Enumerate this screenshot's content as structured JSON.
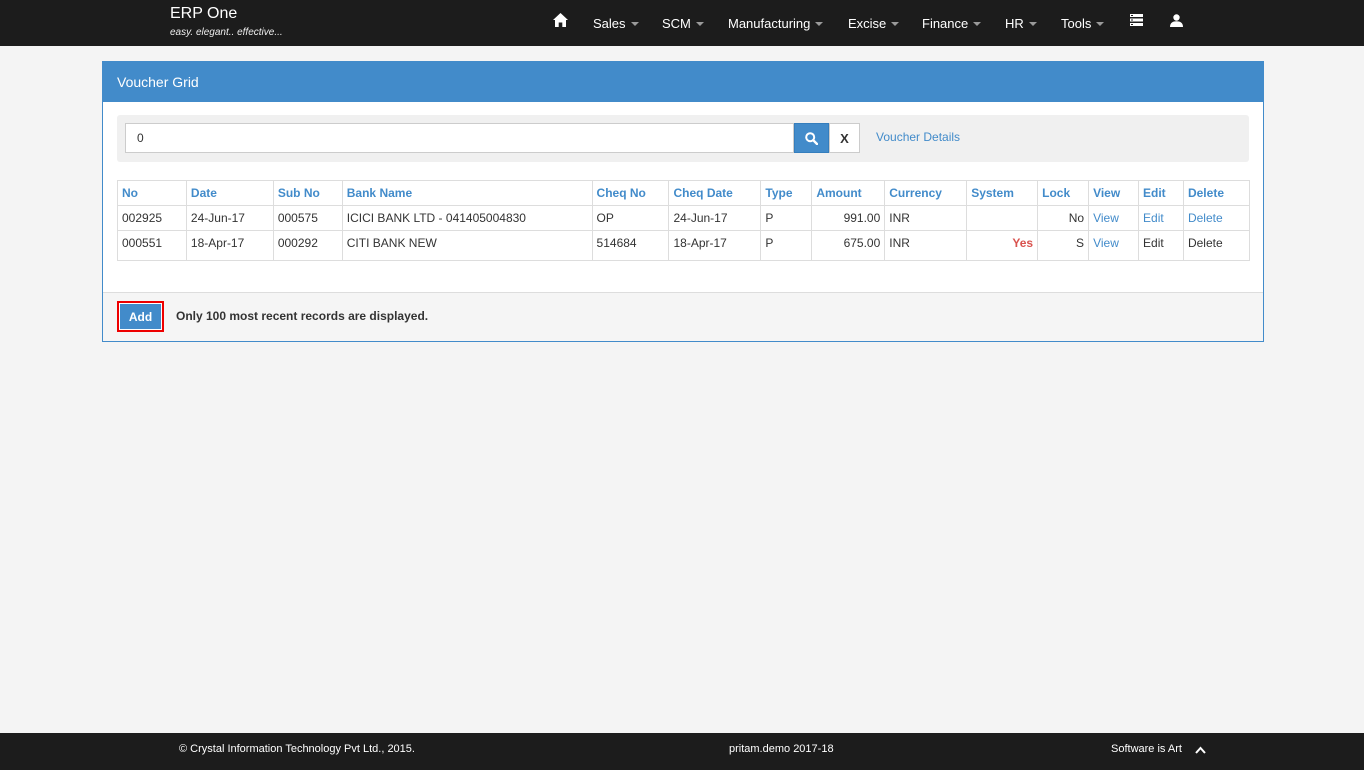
{
  "brand": {
    "title": "ERP One",
    "tagline": "easy. elegant.. effective..."
  },
  "nav": {
    "home_icon": "home-icon",
    "items": [
      "Sales",
      "SCM",
      "Manufacturing",
      "Excise",
      "Finance",
      "HR",
      "Tools"
    ],
    "menu_icon": "list-icon",
    "user_icon": "user-icon"
  },
  "panel": {
    "title": "Voucher Grid",
    "search": {
      "value": "0",
      "button_icon": "search-icon",
      "clear_label": "X"
    },
    "details_link": "Voucher Details"
  },
  "table": {
    "columns": [
      "No",
      "Date",
      "Sub No",
      "Bank Name",
      "Cheq No",
      "Cheq Date",
      "Type",
      "Amount",
      "Currency",
      "System",
      "Lock",
      "View",
      "Edit",
      "Delete"
    ],
    "rows": [
      {
        "no": "002925",
        "date": "24-Jun-17",
        "sub_no": "000575",
        "bank": "ICICI BANK LTD - 041405004830",
        "cheq_no": "OP",
        "cheq_date": "24-Jun-17",
        "type": "P",
        "amount": "991.00",
        "currency": "INR",
        "system": "",
        "lock": "No",
        "view": "View",
        "edit": "Edit",
        "delete": "Delete"
      },
      {
        "no": "000551",
        "date": "18-Apr-17",
        "sub_no": "000292",
        "bank": "CITI BANK NEW",
        "cheq_no": "514684",
        "cheq_date": "18-Apr-17",
        "type": "P",
        "amount": "675.00",
        "currency": "INR",
        "system": "Yes",
        "lock": "S",
        "view": "View",
        "edit": "Edit",
        "delete": "Delete"
      }
    ]
  },
  "footer": {
    "add_label": "Add",
    "note": "Only 100 most recent records are displayed."
  },
  "bottombar": {
    "copyright": "© Crystal Information Technology Pvt Ltd., 2015.",
    "session": "pritam.demo 2017-18",
    "slogan": "Software is Art"
  },
  "colors": {
    "primary": "#428bca",
    "navbar": "#1c1c1c",
    "danger": "#d9534f"
  }
}
